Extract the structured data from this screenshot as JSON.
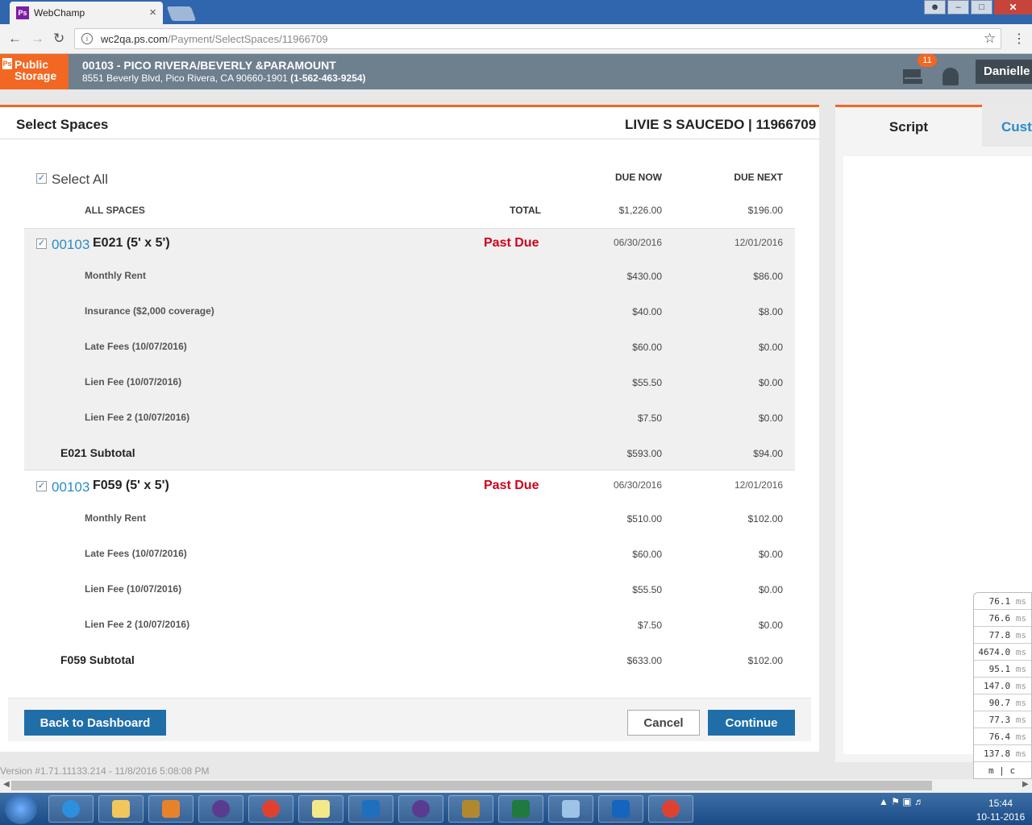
{
  "browser": {
    "tab_title": "WebChamp",
    "tab_favicon": "Ps",
    "tab_close": "×",
    "url_host": "wc2qa.ps.com",
    "url_path": "/Payment/SelectSpaces/11966709"
  },
  "header": {
    "logo_line1": "Public",
    "logo_line2": "Storage",
    "logo_mark": "Ps",
    "store_name": "00103 - PICO RIVERA/BEVERLY &PARAMOUNT",
    "address": "8551 Beverly Blvd, Pico Rivera, CA 90660-1901",
    "phone": "(1-562-463-9254)",
    "notification_count": "11",
    "user_name": "Danielle"
  },
  "page": {
    "title": "Select Spaces",
    "customer": "LIVIE S SAUCEDO | 11966709",
    "select_all": "Select All",
    "col_due_now": "DUE NOW",
    "col_due_next": "DUE NEXT",
    "all_spaces_label": "ALL SPACES",
    "total_label": "TOTAL",
    "total_due_now": "$1,226.00",
    "total_due_next": "$196.00"
  },
  "spaces": [
    {
      "store": "00103",
      "space": "E021 (5' x 5')",
      "status": "Past Due",
      "due_now_date": "06/30/2016",
      "due_next_date": "12/01/2016",
      "lines": [
        {
          "label": "Monthly Rent",
          "now": "$430.00",
          "next": "$86.00"
        },
        {
          "label": "Insurance ($2,000 coverage)",
          "now": "$40.00",
          "next": "$8.00"
        },
        {
          "label": "Late Fees (10/07/2016)",
          "now": "$60.00",
          "next": "$0.00"
        },
        {
          "label": "Lien Fee (10/07/2016)",
          "now": "$55.50",
          "next": "$0.00"
        },
        {
          "label": "Lien Fee 2 (10/07/2016)",
          "now": "$7.50",
          "next": "$0.00"
        }
      ],
      "subtotal_label": "E021 Subtotal",
      "subtotal_now": "$593.00",
      "subtotal_next": "$94.00"
    },
    {
      "store": "00103",
      "space": "F059 (5' x 5')",
      "status": "Past Due",
      "due_now_date": "06/30/2016",
      "due_next_date": "12/01/2016",
      "lines": [
        {
          "label": "Monthly Rent",
          "now": "$510.00",
          "next": "$102.00"
        },
        {
          "label": "Late Fees (10/07/2016)",
          "now": "$60.00",
          "next": "$0.00"
        },
        {
          "label": "Lien Fee (10/07/2016)",
          "now": "$55.50",
          "next": "$0.00"
        },
        {
          "label": "Lien Fee 2 (10/07/2016)",
          "now": "$7.50",
          "next": "$0.00"
        }
      ],
      "subtotal_label": "F059 Subtotal",
      "subtotal_now": "$633.00",
      "subtotal_next": "$102.00"
    }
  ],
  "footer": {
    "back_label": "Back to Dashboard",
    "cancel_label": "Cancel",
    "continue_label": "Continue",
    "version": "Version #1.71.11133.214 - 11/8/2016 5:08:08 PM"
  },
  "right_panel": {
    "tab_script": "Script",
    "tab_customer": "Custo"
  },
  "perf_timings": {
    "values": [
      "76.1",
      "76.6",
      "77.8",
      "4674.0",
      "95.1",
      "147.0",
      "90.7",
      "77.3",
      "76.4",
      "137.8"
    ],
    "unit": "ms",
    "footer": "m | c"
  },
  "taskbar": {
    "time": "15:44",
    "date": "10-11-2016"
  },
  "colors": {
    "brand_orange": "#f26722",
    "header_grey": "#6e7f8e",
    "button_blue": "#1f6ea8",
    "past_due_red": "#d0021b",
    "link_blue": "#2a8bc8"
  }
}
